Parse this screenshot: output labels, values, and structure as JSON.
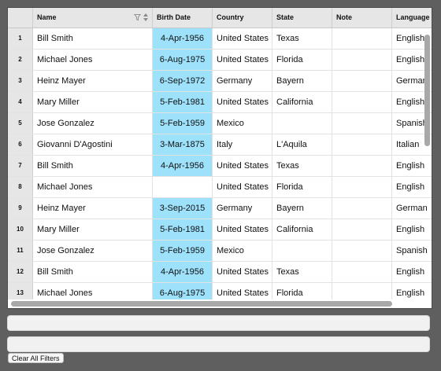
{
  "grid": {
    "columns": [
      {
        "label": ""
      },
      {
        "label": "Name"
      },
      {
        "label": "Birth Date"
      },
      {
        "label": "Country"
      },
      {
        "label": "State"
      },
      {
        "label": "Note"
      },
      {
        "label": "Language"
      }
    ],
    "rows": [
      {
        "num": "1",
        "name": "Bill Smith",
        "birth": "4-Apr-1956",
        "country": "United States",
        "state": "Texas",
        "note": "",
        "language": "English"
      },
      {
        "num": "2",
        "name": "Michael Jones",
        "birth": "6-Aug-1975",
        "country": "United States",
        "state": "Florida",
        "note": "",
        "language": "English"
      },
      {
        "num": "3",
        "name": "Heinz Mayer",
        "birth": "6-Sep-1972",
        "country": "Germany",
        "state": "Bayern",
        "note": "",
        "language": "German"
      },
      {
        "num": "4",
        "name": "Mary Miller",
        "birth": "5-Feb-1981",
        "country": "United States",
        "state": "California",
        "note": "",
        "language": "English"
      },
      {
        "num": "5",
        "name": "Jose Gonzalez",
        "birth": "5-Feb-1959",
        "country": "Mexico",
        "state": "",
        "note": "",
        "language": "Spanish"
      },
      {
        "num": "6",
        "name": "Giovanni D'Agostini",
        "birth": "3-Mar-1875",
        "country": "Italy",
        "state": "L'Aquila",
        "note": "",
        "language": "Italian"
      },
      {
        "num": "7",
        "name": "Bill Smith",
        "birth": "4-Apr-1956",
        "country": "United States",
        "state": "Texas",
        "note": "",
        "language": "English"
      },
      {
        "num": "8",
        "name": "Michael Jones",
        "birth": "",
        "country": "United States",
        "state": "Florida",
        "note": "",
        "language": "English"
      },
      {
        "num": "9",
        "name": "Heinz Mayer",
        "birth": "3-Sep-2015",
        "country": "Germany",
        "state": "Bayern",
        "note": "",
        "language": "German"
      },
      {
        "num": "10",
        "name": "Mary Miller",
        "birth": "5-Feb-1981",
        "country": "United States",
        "state": "California",
        "note": "",
        "language": "English"
      },
      {
        "num": "11",
        "name": "Jose Gonzalez",
        "birth": "5-Feb-1959",
        "country": "Mexico",
        "state": "",
        "note": "",
        "language": "Spanish"
      },
      {
        "num": "12",
        "name": "Bill Smith",
        "birth": "4-Apr-1956",
        "country": "United States",
        "state": "Texas",
        "note": "",
        "language": "English"
      },
      {
        "num": "13",
        "name": "Michael Jones",
        "birth": "6-Aug-1975",
        "country": "United States",
        "state": "Florida",
        "note": "",
        "language": "English"
      }
    ]
  },
  "filters": {
    "filter_one_value": "",
    "filter_two_value": "",
    "clear_label": "Clear All Filters"
  },
  "colors": {
    "date_highlight": "#9de1fb",
    "background": "#5f5f5f"
  },
  "icons": {
    "name_filter": "funnel-icon",
    "name_sort": "sort-updown-icon"
  }
}
